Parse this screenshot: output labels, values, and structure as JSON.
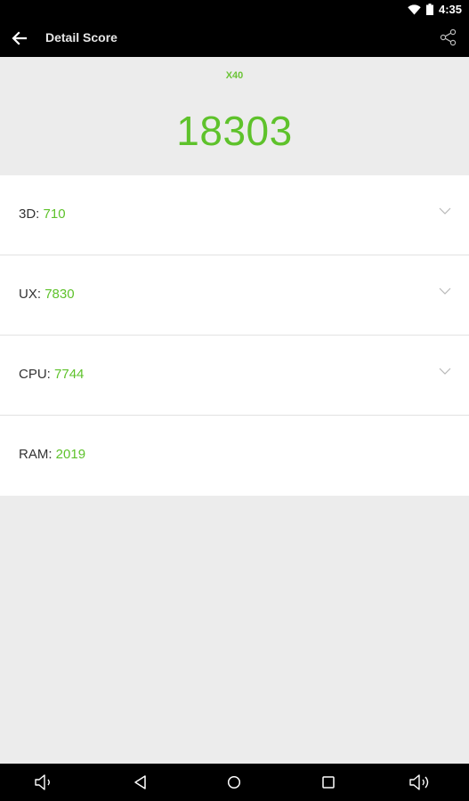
{
  "status_bar": {
    "time": "4:35",
    "icons": [
      "wifi-icon",
      "battery-icon"
    ]
  },
  "app_bar": {
    "title": "Detail Score",
    "back_icon": "arrow-left-icon",
    "share_icon": "share-icon"
  },
  "header": {
    "device": "X40",
    "total_score": "18303"
  },
  "scores": [
    {
      "label": "3D:",
      "value": "710",
      "expandable": true
    },
    {
      "label": "UX:",
      "value": "7830",
      "expandable": true
    },
    {
      "label": "CPU:",
      "value": "7744",
      "expandable": true
    },
    {
      "label": "RAM:",
      "value": "2019",
      "expandable": false
    }
  ],
  "nav_bar": {
    "items": [
      "volume-down-icon",
      "back-triangle-icon",
      "home-circle-icon",
      "recents-square-icon",
      "volume-up-icon"
    ]
  },
  "colors": {
    "accent_green": "#5ec22b",
    "bar_background": "#000000",
    "page_background": "#ececec"
  }
}
